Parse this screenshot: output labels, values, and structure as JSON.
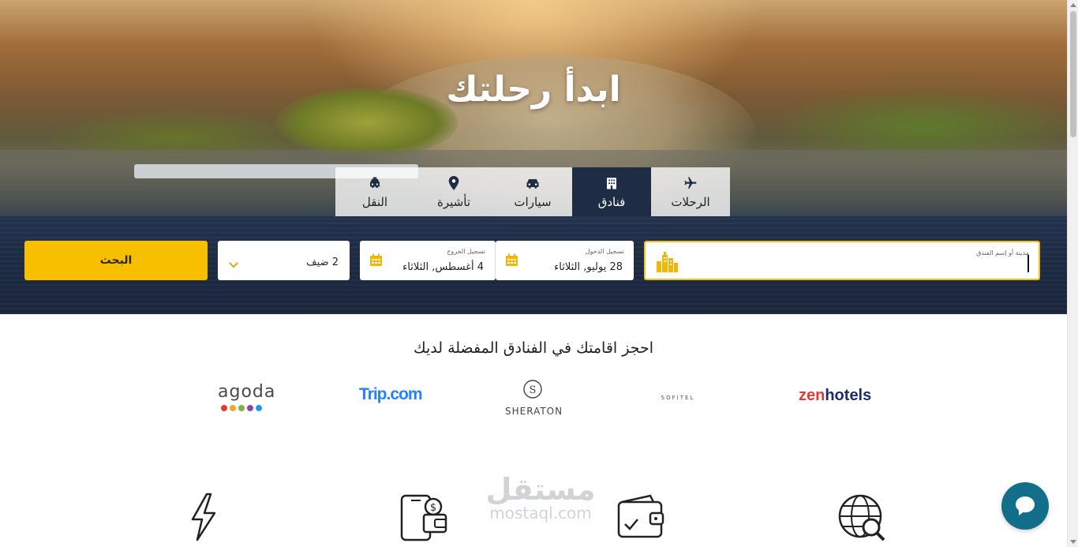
{
  "hero": {
    "title": "ابدأ رحلتك"
  },
  "tabs": [
    {
      "label": "الرحلات",
      "icon": "plane-icon",
      "active": false
    },
    {
      "label": "فنادق",
      "icon": "hotel-icon",
      "active": true
    },
    {
      "label": "سيارات",
      "icon": "car-icon",
      "active": false
    },
    {
      "label": "تأشيرة",
      "icon": "map-pin-icon",
      "active": false
    },
    {
      "label": "النقل",
      "icon": "taxi-icon",
      "active": false
    }
  ],
  "search": {
    "destination_label": "مدينة أو إسم الفندق",
    "destination_value": "",
    "checkin_label": "تسجيل الدخول",
    "checkin_value": "28 يوليو, الثلاثاء",
    "checkout_label": "تسجيل الخروج",
    "checkout_value": "4 أغسطس, الثلاثاء",
    "guests_value": "2 ضيف",
    "search_button": "البحث"
  },
  "partners": {
    "title": "احجز اقامتك في الفنادق المفضلة لديك",
    "agoda": "agoda",
    "trip": "Trip.com",
    "sheraton": "SHERATON",
    "sofitel": "SOFITEL",
    "zen_a": "zen",
    "zen_b": "hotels"
  },
  "watermark": {
    "arabic": "مستقل",
    "latin": "mostaql.com"
  },
  "colors": {
    "accent": "#f7bf00",
    "navy": "#1f2c45",
    "chat": "#136e8a"
  }
}
